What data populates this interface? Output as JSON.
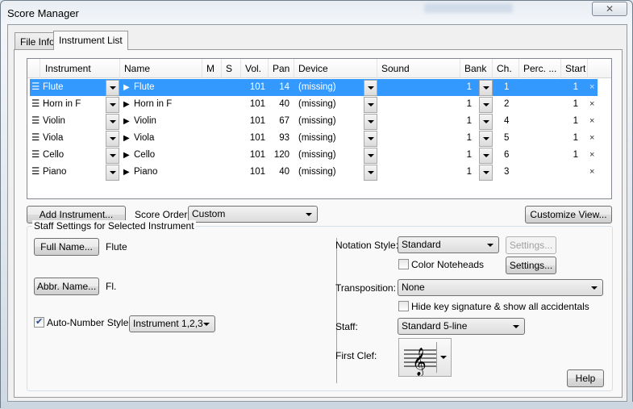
{
  "window": {
    "title": "Score Manager",
    "close_glyph": "✕"
  },
  "tabs": [
    {
      "label": "File Info"
    },
    {
      "label": "Instrument List"
    }
  ],
  "grid": {
    "columns": [
      "Instrument",
      "Name",
      "M",
      "S",
      "Vol.",
      "Pan",
      "Device",
      "Sound",
      "Bank",
      "Ch.",
      "Perc. ...",
      "Start"
    ],
    "rows": [
      {
        "instrument": "Flute",
        "name": "Flute",
        "vol": "101",
        "pan": "14",
        "device": "(missing)",
        "sound": "",
        "bank": "1",
        "ch": "1",
        "perc": "",
        "start": "1",
        "selected": true
      },
      {
        "instrument": "Horn in F",
        "name": "Horn in F",
        "vol": "101",
        "pan": "40",
        "device": "(missing)",
        "sound": "",
        "bank": "1",
        "ch": "2",
        "perc": "",
        "start": "1",
        "selected": false
      },
      {
        "instrument": "Violin",
        "name": "Violin",
        "vol": "101",
        "pan": "67",
        "device": "(missing)",
        "sound": "",
        "bank": "1",
        "ch": "4",
        "perc": "",
        "start": "1",
        "selected": false
      },
      {
        "instrument": "Viola",
        "name": "Viola",
        "vol": "101",
        "pan": "93",
        "device": "(missing)",
        "sound": "",
        "bank": "1",
        "ch": "5",
        "perc": "",
        "start": "1",
        "selected": false
      },
      {
        "instrument": "Cello",
        "name": "Cello",
        "vol": "101",
        "pan": "120",
        "device": "(missing)",
        "sound": "",
        "bank": "1",
        "ch": "6",
        "perc": "",
        "start": "1",
        "selected": false
      },
      {
        "instrument": "Piano",
        "name": "Piano",
        "vol": "101",
        "pan": "40",
        "device": "(missing)",
        "sound": "",
        "bank": "1",
        "ch": "3",
        "perc": "",
        "start": "",
        "selected": false
      }
    ],
    "drag_glyph": "☰",
    "expand_glyph": "▶",
    "delete_glyph": "×"
  },
  "controls": {
    "add_instrument": "Add Instrument...",
    "score_order_label": "Score Order:",
    "score_order_value": "Custom",
    "customize_view": "Customize View..."
  },
  "staff_settings": {
    "group_label": "Staff Settings for Selected Instrument",
    "full_name_button": "Full Name...",
    "full_name_value": "Flute",
    "abbr_name_button": "Abbr. Name...",
    "abbr_name_value": "Fl.",
    "auto_number_label": "Auto-Number Style:",
    "auto_number_checked": true,
    "auto_number_value": "Instrument 1,2,3",
    "notation_style_label": "Notation Style:",
    "notation_style_value": "Standard",
    "notation_settings_button": "Settings...",
    "color_noteheads_label": "Color Noteheads",
    "color_noteheads_checked": false,
    "color_settings_button": "Settings...",
    "transposition_label": "Transposition:",
    "transposition_value": "None",
    "hide_key_label": "Hide key signature & show all accidentals",
    "hide_key_checked": false,
    "staff_label": "Staff:",
    "staff_value": "Standard 5-line",
    "first_clef_label": "First Clef:",
    "clef_glyph": "𝄞",
    "help_button": "Help"
  }
}
